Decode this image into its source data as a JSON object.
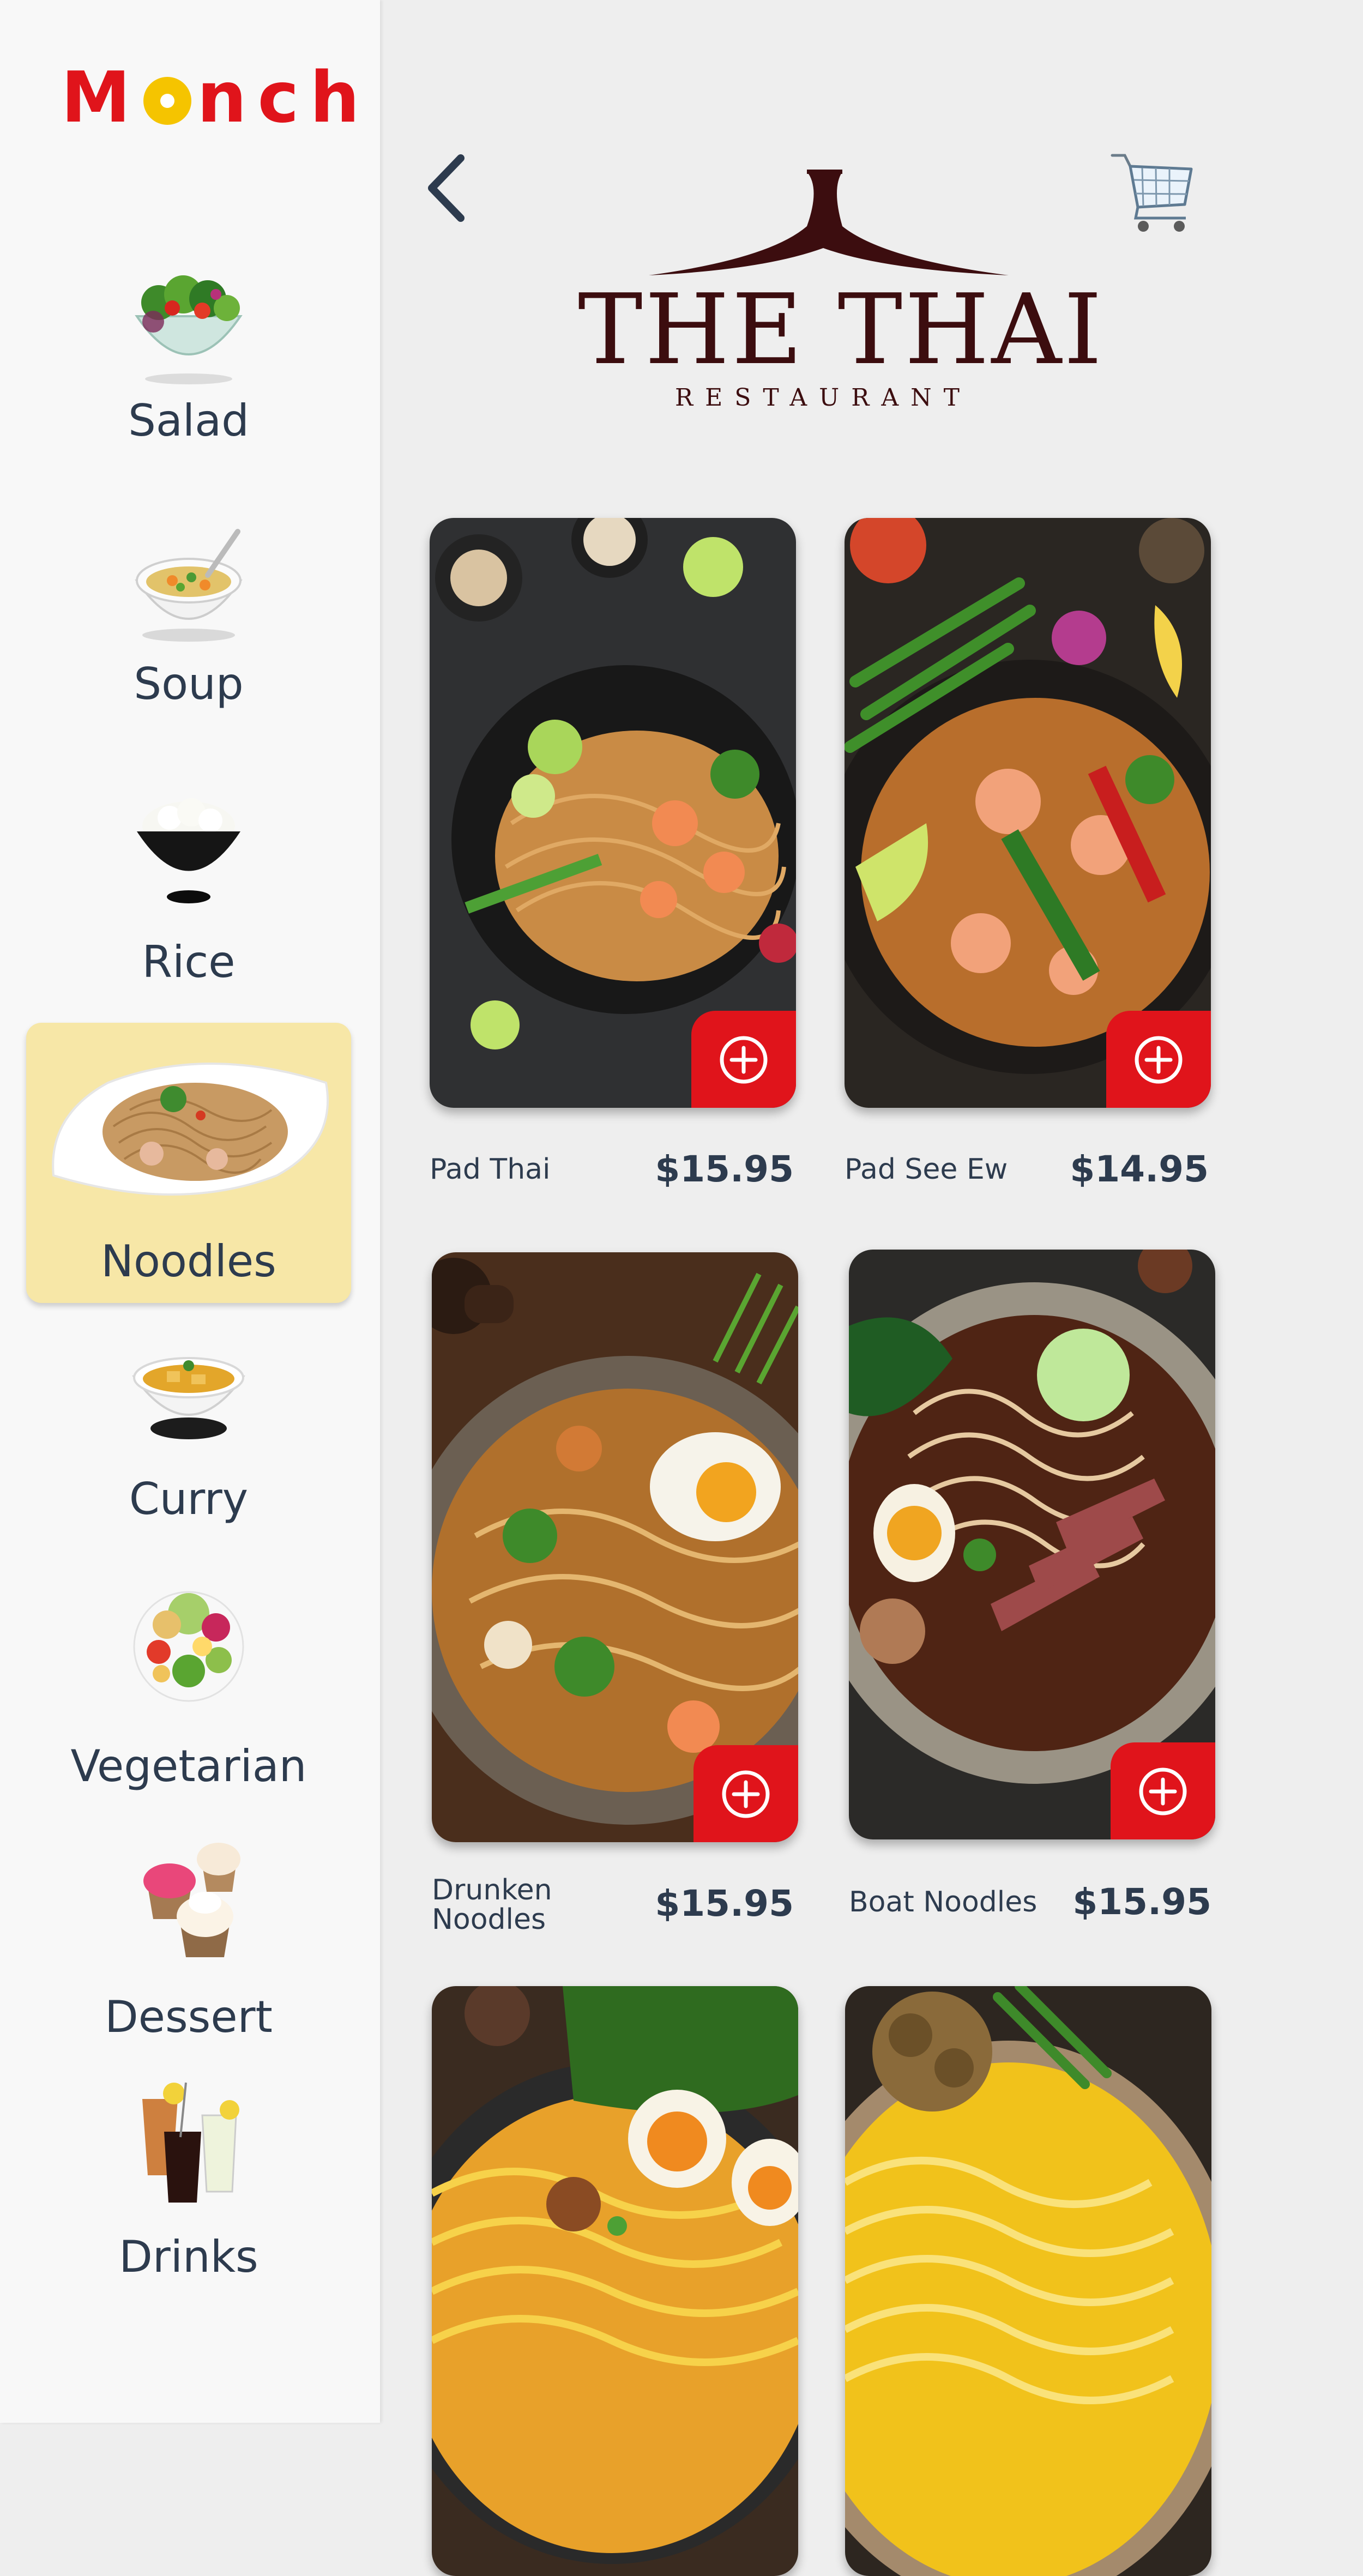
{
  "app": {
    "logo": "Monch"
  },
  "sidebar": {
    "categories": [
      {
        "label": "Salad",
        "icon": "salad-bowl"
      },
      {
        "label": "Soup",
        "icon": "soup-bowl"
      },
      {
        "label": "Rice",
        "icon": "rice-bowl"
      },
      {
        "label": "Noodles",
        "icon": "noodles-plate",
        "active": true
      },
      {
        "label": "Curry",
        "icon": "curry-bowl"
      },
      {
        "label": "Vegetarian",
        "icon": "vegetarian-plate"
      },
      {
        "label": "Dessert",
        "icon": "cupcakes"
      },
      {
        "label": "Drinks",
        "icon": "drinks"
      }
    ]
  },
  "header": {
    "back_icon": "chevron-left-icon",
    "cart_icon": "shopping-cart-icon",
    "restaurant_name": "THE THAI",
    "restaurant_sub": "RESTAURANT"
  },
  "menu": {
    "items": [
      {
        "name": "Pad Thai",
        "price": "$15.95"
      },
      {
        "name": "Pad See Ew",
        "price": "$14.95"
      },
      {
        "name": "Drunken Noodles",
        "price": "$15.95"
      },
      {
        "name": "Boat Noodles",
        "price": "$15.95"
      },
      {
        "name": "",
        "price": ""
      },
      {
        "name": "",
        "price": ""
      }
    ]
  },
  "colors": {
    "accent": "#e0141b",
    "logo_dot": "#f5c400",
    "active_category_bg": "#f7e7a7",
    "text": "#2d3b4e",
    "brand_text": "#3c0d0f"
  }
}
